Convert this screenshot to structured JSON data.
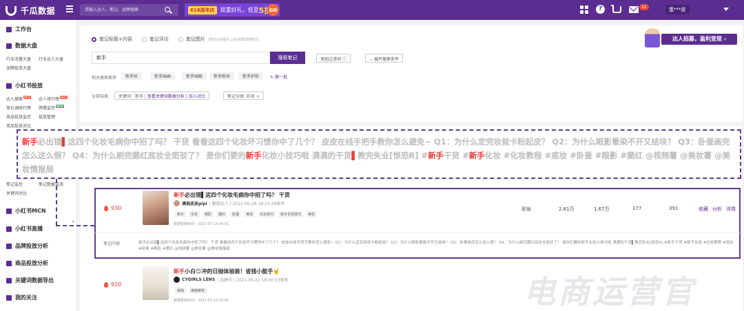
{
  "topbar": {
    "brand": "千瓜数据",
    "search_placeholder": "请输入达人、笔记、品牌搜索",
    "promo_badge": "618周年庆",
    "promo_text": "双重好礼，低至",
    "promo_number": "5折",
    "promo_go": "GO",
    "mail_count": "12",
    "user_name": "蛋***皮"
  },
  "sidebar": {
    "workbench": "工作台",
    "data_board": "数据大盘",
    "data_board_items": [
      "行业流量大盘",
      "行业达人大盘",
      "品牌投放大盘"
    ],
    "xhs_deliver": "小红书投放",
    "deliver_items": [
      "达人搜索",
      "达人排行榜",
      "竞价调研行榜",
      "舆情监控",
      "竞品投放监控",
      "投放管理",
      "竞品投放对比"
    ],
    "hidden_items": [
      "笔记监控",
      "笔记数据监测",
      "关键词对比"
    ],
    "mcn": "小红书MCN",
    "live": "小红书直播",
    "brand_analysis": "品牌投放分析",
    "goods_analysis": "商品投放分析",
    "keyword_export": "关键词数据导出",
    "my_follow": "我的关注",
    "collapse": "«"
  },
  "search_panel": {
    "radios": [
      {
        "label": "笔记标题+内容",
        "selected": true
      },
      {
        "label": "笔记评论",
        "selected": false
      },
      {
        "label": "笔记图片",
        "selected": false,
        "hint": "(通过识别图片上的关键词搜笔记)"
      }
    ],
    "keyword_value": "新手",
    "search_button": "搜索笔记",
    "add_filter": "添加过滤词 ⓘ",
    "expand_filter": "展开搜索条件",
    "related_label": "相关搜索推荐",
    "related_tags": [
      "新手机",
      "新手画画",
      "新手画眼",
      "新手粉饰",
      "新手护肤"
    ],
    "related_more": "换一批",
    "filter_label": "全部结果:",
    "filter_chip_1_prefix": "关键词：新手 |",
    "filter_chip_1_link": "查看关键词数据分析 | 加入对比",
    "filter_chip_2": "笔记分类: 彩妆 ×"
  },
  "overlay": {
    "segments": [
      {
        "t": "新手",
        "c": "hl"
      },
      {
        "t": "必出错",
        "c": "dim"
      },
      {
        "t": "▌",
        "c": "hl"
      },
      {
        "t": "这四个化妆毛病你中招了吗？ 干货 看看这四个化妆坏习惯你中了几个？ 皮皮在线手把手教你怎么避免~ Q1：为什么定完妆就卡粉起皮？ Q2：为什么眼影晕染不开又结块？ Q3：卧蚕画完怎么这么假？ Q4：为什么刷完腮红底妆全斑驳了？ 是你们要的",
        "c": "dim"
      },
      {
        "t": "新手",
        "c": "hl"
      },
      {
        "t": "化妆小技巧啦 满满的干货",
        "c": "dim"
      },
      {
        "t": "▌",
        "c": "hl"
      },
      {
        "t": "教完失业[惊恐R] #",
        "c": "dim"
      },
      {
        "t": "新手",
        "c": "hl"
      },
      {
        "t": "干货 #",
        "c": "dim"
      },
      {
        "t": "新手",
        "c": "hl"
      },
      {
        "t": "化妆 #化妆教程 #底妆 #卧蚕 #眼影 #腮红 @视频薯 @美妆薯 @美妆情报局",
        "c": "dim"
      }
    ]
  },
  "row1": {
    "score": "930",
    "title_hl": "新手",
    "title_rest": "必出错▌这四个化妆毛病你中招了吗？ 干货",
    "author": "满翁皮皮pipi",
    "author_meta": "| 腰部达人 | 2021-06-28 18:24:28发布",
    "tags": [
      "新手",
      "化妆",
      "眼影",
      "腮红",
      "卧蚕",
      "美妆",
      "化妆技巧",
      "新手化妆技巧",
      "美妆"
    ],
    "updated": "数据更新时间：2021-07-13 09:01",
    "category": "彩妆",
    "likes": "2.81万",
    "collects": "1.67万",
    "comments": "177",
    "shares": "391",
    "actions": [
      "收藏",
      "分析",
      "详情"
    ],
    "content_label": "笔记内容",
    "content_text": "新手必出错▌这四个化妆毛病你中招了吗？ 干货 看看这四个化妆坏习惯你中了几个？ 皮皮在线手把手教你怎么避免~ Q1：为什么定完妆就卡粉起皮？ Q2：为什么眼影晕染不开又结块？ Q3：卧蚕画完怎么这么假？ Q4：为什么刷完腮红底妆全斑驳了？ 是你们要的新手化妆小技巧啦 满满的干货▌教完失业[惊恐R] #新手干货 #新手化妆 #化妆教程 #底妆 #卧蚕 #眼影 #腮红 @视频薯 @美妆薯 @美妆情报局"
  },
  "row2": {
    "score": "920",
    "title_hl": "新手",
    "title_rest": "小白😊冲的日抛体验装！省钱小能手🤘",
    "author": "CYGIRLS LENS",
    "author_meta": "| 品牌号 | 2021-06-22 18:00:53发布",
    "tags": [
      "美瞳",
      "美瞳推荐"
    ],
    "updated": "数据更新时间：2021-07-12 20:50"
  },
  "recruit": {
    "label": "达人招募，盈利变现 ›"
  },
  "watermark": "电商运营官"
}
